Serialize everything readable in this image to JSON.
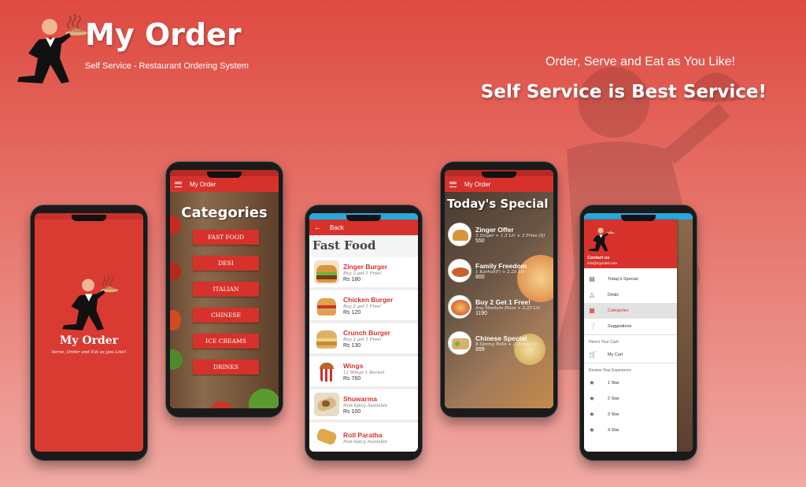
{
  "brand": {
    "title": "My Order",
    "subtitle": "Self Service - Restaurant Ordering System"
  },
  "hero": {
    "tagline": "Order, Serve and Eat as You Like!",
    "headline": "Self Service is Best Service!"
  },
  "colors": {
    "primary": "#d6322b",
    "background": "#e35a50"
  },
  "splash": {
    "title": "My Order",
    "subtitle": "Serve, Order and Eat as you Like!"
  },
  "categories_screen": {
    "appbar_title": "My Order",
    "heading": "Categories",
    "items": [
      "FAST FOOD",
      "DESI",
      "ITALIAN",
      "CHINESE",
      "ICE CREAMS",
      "DRINKS"
    ]
  },
  "fastfood_screen": {
    "back_label": "Back",
    "heading": "Fast Food",
    "items": [
      {
        "name": "Zinger Burger",
        "desc": "Buy 2 get 1 Free!",
        "price": "Rs 180"
      },
      {
        "name": "Chicken Burger",
        "desc": "Buy 2 get 1 Free!",
        "price": "Rs 120"
      },
      {
        "name": "Crunch Burger",
        "desc": "Buy 2 get 1 Free!",
        "price": "Rs 130"
      },
      {
        "name": "Wings",
        "desc": "12 Wings 1 Bucket",
        "price": "Rs 760"
      },
      {
        "name": "Shuwarma",
        "desc": "Non-Spicy Available",
        "price": "Rs 100"
      },
      {
        "name": "Roll Paratha",
        "desc": "Non-Spicy Available",
        "price": ""
      }
    ]
  },
  "special_screen": {
    "appbar_title": "My Order",
    "heading": "Today's Special",
    "items": [
      {
        "name": "Zinger Offer",
        "desc": "3 Zinger + 1.5 Ltr + 3 Fries (S)",
        "price": "550"
      },
      {
        "name": "Family Freedom",
        "desc": "1 Karhai(F) + 2.25 Ltr",
        "price": "800"
      },
      {
        "name": "Buy 2 Get 1 Free!",
        "desc": "Any Medium Pizza + 2.25 Ltr",
        "price": "1190"
      },
      {
        "name": "Chinese Special",
        "desc": "8 Spring Rolls + 2 Drinks (J)",
        "price": "999"
      }
    ]
  },
  "drawer": {
    "contact_title": "Contact us",
    "contact_email": "info@myorder.com",
    "main_items": [
      {
        "label": "Today's Special",
        "icon": "menu-book-icon"
      },
      {
        "label": "Deals",
        "icon": "cloche-icon"
      },
      {
        "label": "Categories",
        "icon": "list-icon"
      },
      {
        "label": "Suggestions",
        "icon": "help-icon"
      }
    ],
    "cart_section": "Here's Your Cart!",
    "cart_item": "My Cart",
    "review_section": "Review Your Experience",
    "stars": [
      "1 Star",
      "2 Star",
      "3 Star",
      "4 Star"
    ]
  }
}
